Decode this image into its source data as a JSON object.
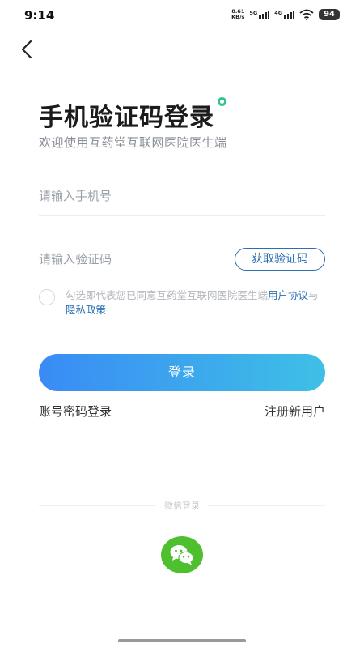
{
  "status_bar": {
    "time": "9:14",
    "net_speed_value": "8.61",
    "net_speed_unit": "KB/s",
    "signal1_label": "5G",
    "signal2_label": "4G",
    "battery": "94"
  },
  "header": {
    "title": "手机验证码登录",
    "subtitle": "欢迎使用互药堂互联网医院医生端"
  },
  "form": {
    "phone_placeholder": "请输入手机号",
    "code_placeholder": "请输入验证码",
    "get_code_label": "获取验证码"
  },
  "agreement": {
    "prefix": "勾选即代表您已同意互药堂互联网医院医生端",
    "user_agreement": "用户协议",
    "connector": "与",
    "privacy_policy": "隐私政策"
  },
  "actions": {
    "login_label": "登录",
    "password_login_label": "账号密码登录",
    "register_label": "注册新用户"
  },
  "third_party": {
    "label": "微信登录"
  },
  "colors": {
    "accent_blue": "#2a6fb0",
    "gradient_start": "#3a8bf5",
    "gradient_end": "#3ec0e6",
    "wechat_green": "#4ec02f",
    "title_dot_green": "#36c28a"
  }
}
